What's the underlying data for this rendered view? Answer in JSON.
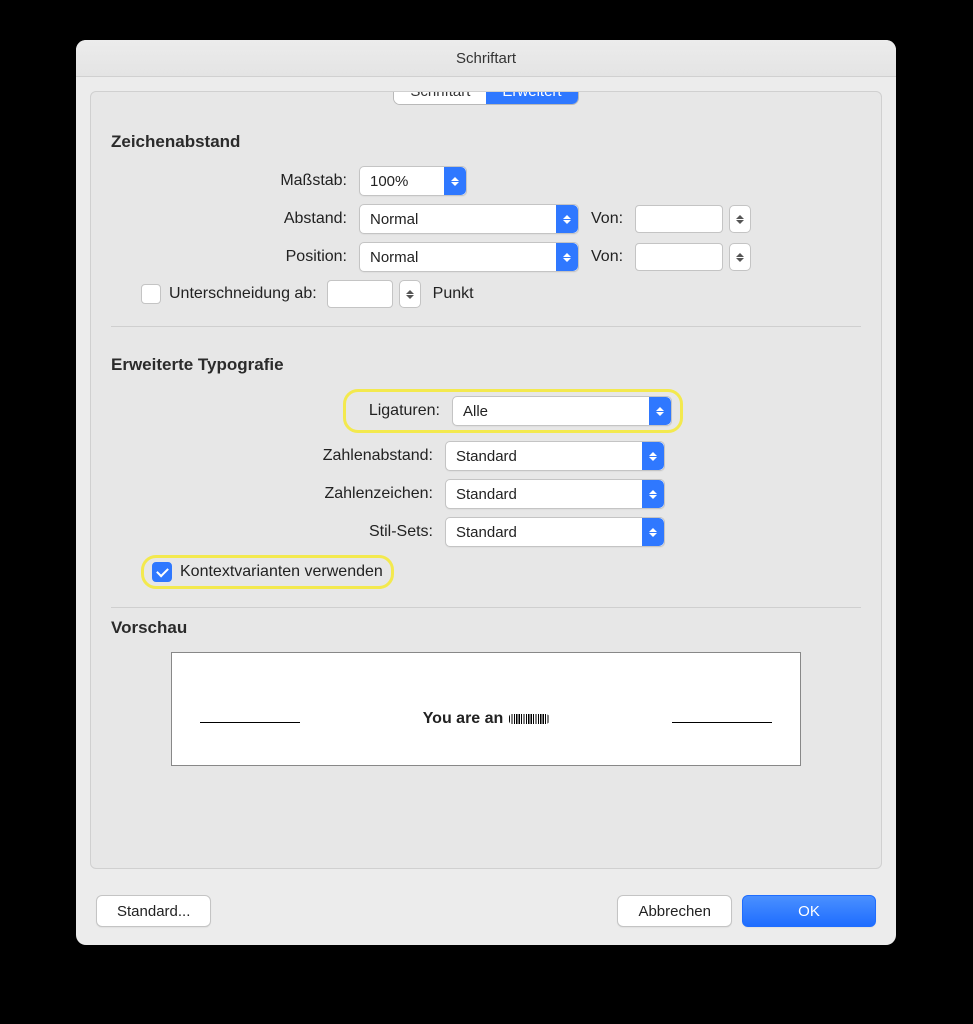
{
  "window": {
    "title": "Schriftart"
  },
  "tabs": {
    "schriftart": "Schriftart",
    "erweitert": "Erweitert"
  },
  "sections": {
    "zeichenabstand": "Zeichenabstand",
    "typografie": "Erweiterte Typografie",
    "vorschau": "Vorschau"
  },
  "zeichenabstand": {
    "massstab_label": "Maßstab:",
    "massstab_value": "100%",
    "abstand_label": "Abstand:",
    "abstand_value": "Normal",
    "position_label": "Position:",
    "position_value": "Normal",
    "von_label": "Von:",
    "unterschneidung_label": "Unterschneidung ab:",
    "punkt_label": "Punkt"
  },
  "typografie": {
    "ligaturen_label": "Ligaturen:",
    "ligaturen_value": "Alle",
    "zahlenabstand_label": "Zahlenabstand:",
    "zahlenabstand_value": "Standard",
    "zahlenzeichen_label": "Zahlenzeichen:",
    "zahlenzeichen_value": "Standard",
    "stilsets_label": "Stil-Sets:",
    "stilsets_value": "Standard",
    "kontext_label": "Kontextvarianten verwenden"
  },
  "vorschau": {
    "text": "You are an"
  },
  "footer": {
    "standard": "Standard...",
    "abbrechen": "Abbrechen",
    "ok": "OK"
  }
}
